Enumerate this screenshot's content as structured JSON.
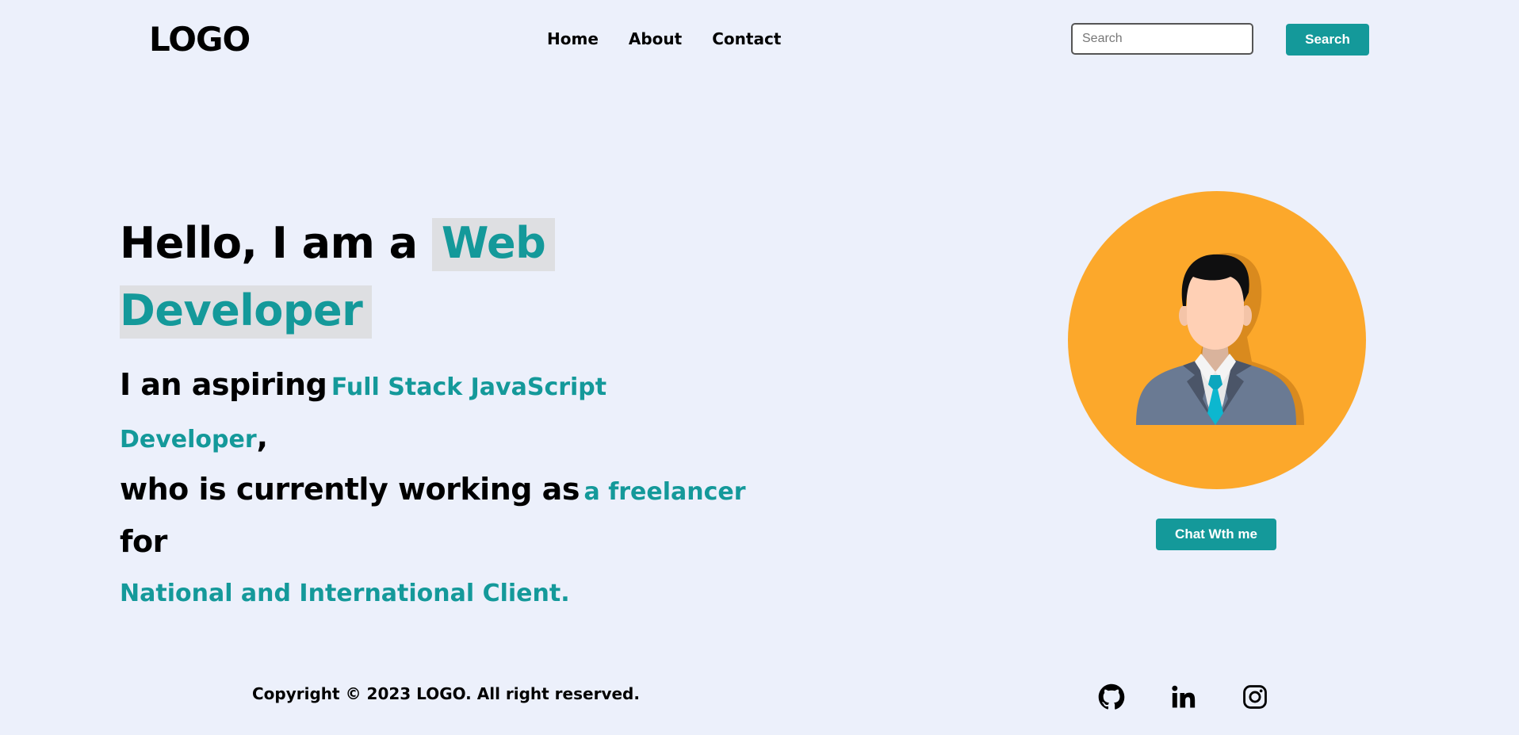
{
  "header": {
    "logo": "LOGO",
    "nav": [
      "Home",
      "About",
      "Contact"
    ],
    "search_placeholder": "Search",
    "search_button": "Search"
  },
  "hero": {
    "greeting": "Hello, I am a",
    "role_line1": "Web",
    "role_line2": "Developer",
    "intro_prefix": "I an aspiring",
    "intro_highlight_1": "Full Stack JavaScript",
    "intro_highlight_2": "Developer",
    "intro_comma": ",",
    "work_prefix": "who is currently working as",
    "work_highlight": "a freelancer",
    "work_suffix": "for",
    "clients": "National and International Client."
  },
  "avatar": {
    "icon": "businessman-avatar-icon"
  },
  "cta": {
    "chat_button": "Chat Wth me"
  },
  "footer": {
    "copyright": "Copyright © 2023 LOGO. All right reserved.",
    "social": [
      "github-icon",
      "linkedin-icon",
      "instagram-icon"
    ]
  },
  "colors": {
    "background": "#ECF0FB",
    "accent": "#14999A",
    "highlight_bg": "#DEDFE2",
    "avatar_bg": "#FCA82B"
  }
}
